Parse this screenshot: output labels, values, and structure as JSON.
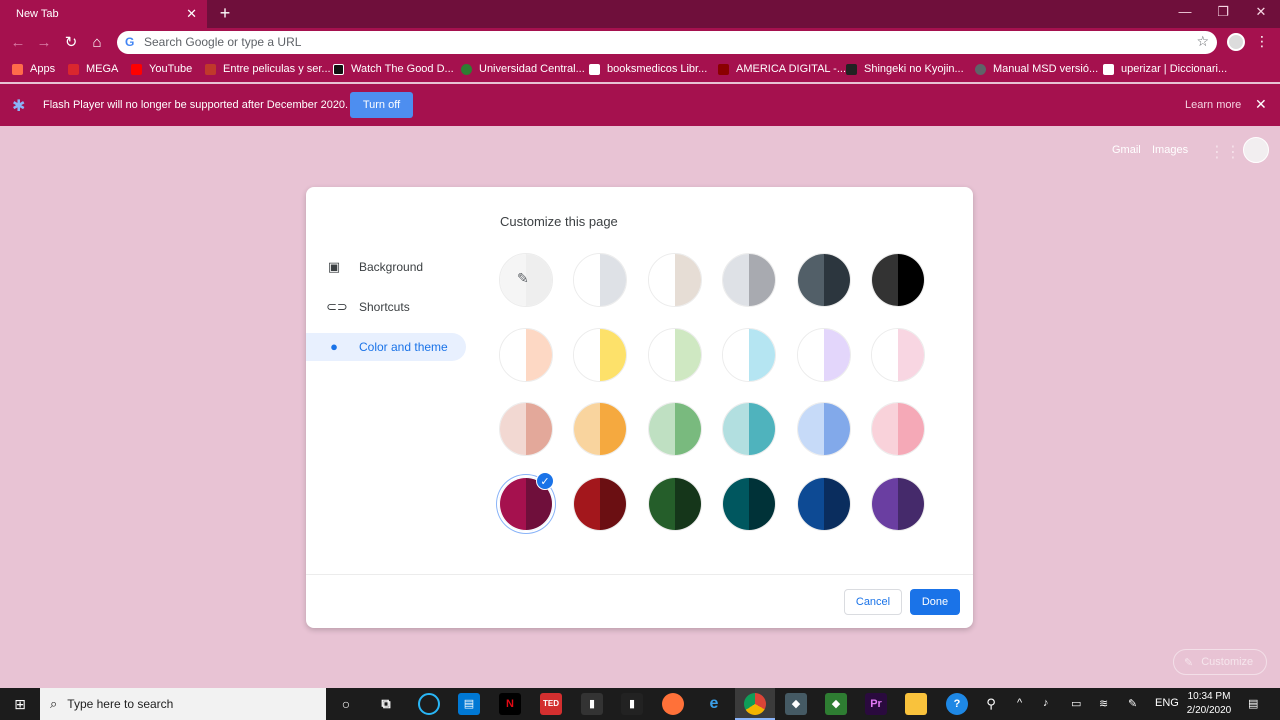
{
  "browser": {
    "tab_title": "New Tab",
    "new_tab": "+",
    "address_placeholder": "Search Google or type a URL",
    "window_controls": [
      "—",
      "❐",
      "✕"
    ]
  },
  "bookmarks": [
    {
      "label": "Apps",
      "color": "#ff6b4a"
    },
    {
      "label": "MEGA",
      "color": "#d9272e"
    },
    {
      "label": "YouTube",
      "color": "#ff0000"
    },
    {
      "label": "Entre peliculas y ser...",
      "color": "#c0392b"
    },
    {
      "label": "Watch The Good D...",
      "color": "#111111"
    },
    {
      "label": "Universidad Central...",
      "color": "#2e7d32"
    },
    {
      "label": "booksmedicos Libr...",
      "color": "#ffffff"
    },
    {
      "label": "AMERICA DIGITAL -...",
      "color": "#8b0000"
    },
    {
      "label": "Shingeki no Kyojin...",
      "color": "#222222"
    },
    {
      "label": "Manual MSD versió...",
      "color": "#5f6368"
    },
    {
      "label": "uperizar | Diccionari...",
      "color": "#ffffff"
    }
  ],
  "flash_bar": {
    "message": "Flash Player will no longer be supported after December 2020.",
    "button": "Turn off",
    "learn_more": "Learn more"
  },
  "ntp": {
    "gmail": "Gmail",
    "images": "Images",
    "customize": "Customize"
  },
  "dialog": {
    "title": "Customize this page",
    "sidebar": [
      {
        "label": "Background",
        "icon": "image-icon"
      },
      {
        "label": "Shortcuts",
        "icon": "link-icon"
      },
      {
        "label": "Color and theme",
        "icon": "palette-icon",
        "active": true
      }
    ],
    "cancel": "Cancel",
    "done": "Done",
    "swatches": [
      [
        {
          "l": "#f5f5f5",
          "r": "#eeeeee",
          "picker": true
        },
        {
          "l": "#ffffff",
          "r": "#dee1e6"
        },
        {
          "l": "#ffffff",
          "r": "#e6ddd5"
        },
        {
          "l": "#dee1e6",
          "r": "#a8aab0"
        },
        {
          "l": "#525f68",
          "r": "#2c363e"
        },
        {
          "l": "#333333",
          "r": "#000000"
        }
      ],
      [
        {
          "l": "#ffffff",
          "r": "#fdd8c4"
        },
        {
          "l": "#ffffff",
          "r": "#fde16a"
        },
        {
          "l": "#ffffff",
          "r": "#cfe8c2"
        },
        {
          "l": "#ffffff",
          "r": "#b5e5f2"
        },
        {
          "l": "#ffffff",
          "r": "#e3d6fb"
        },
        {
          "l": "#ffffff",
          "r": "#f8d6e2"
        }
      ],
      [
        {
          "l": "#f2d8d2",
          "r": "#e3a89a"
        },
        {
          "l": "#f9d49e",
          "r": "#f5a93f"
        },
        {
          "l": "#bfe0c2",
          "r": "#79ba7e"
        },
        {
          "l": "#b2dfe0",
          "r": "#4fb3bd"
        },
        {
          "l": "#c6daf8",
          "r": "#82a9ea"
        },
        {
          "l": "#f9d2da",
          "r": "#f5a9b7"
        }
      ],
      [
        {
          "l": "#a5114e",
          "r": "#6f0f3b",
          "selected": true
        },
        {
          "l": "#a3171c",
          "r": "#6b0f12"
        },
        {
          "l": "#255e2a",
          "r": "#15361a"
        },
        {
          "l": "#00575f",
          "r": "#003238"
        },
        {
          "l": "#0d4a94",
          "r": "#0a2d5e"
        },
        {
          "l": "#6a3ea1",
          "r": "#452a6b"
        }
      ]
    ]
  },
  "taskbar": {
    "search_placeholder": "Type here to search",
    "language": "ENG",
    "time": "10:34 PM",
    "date": "2/20/2020"
  }
}
